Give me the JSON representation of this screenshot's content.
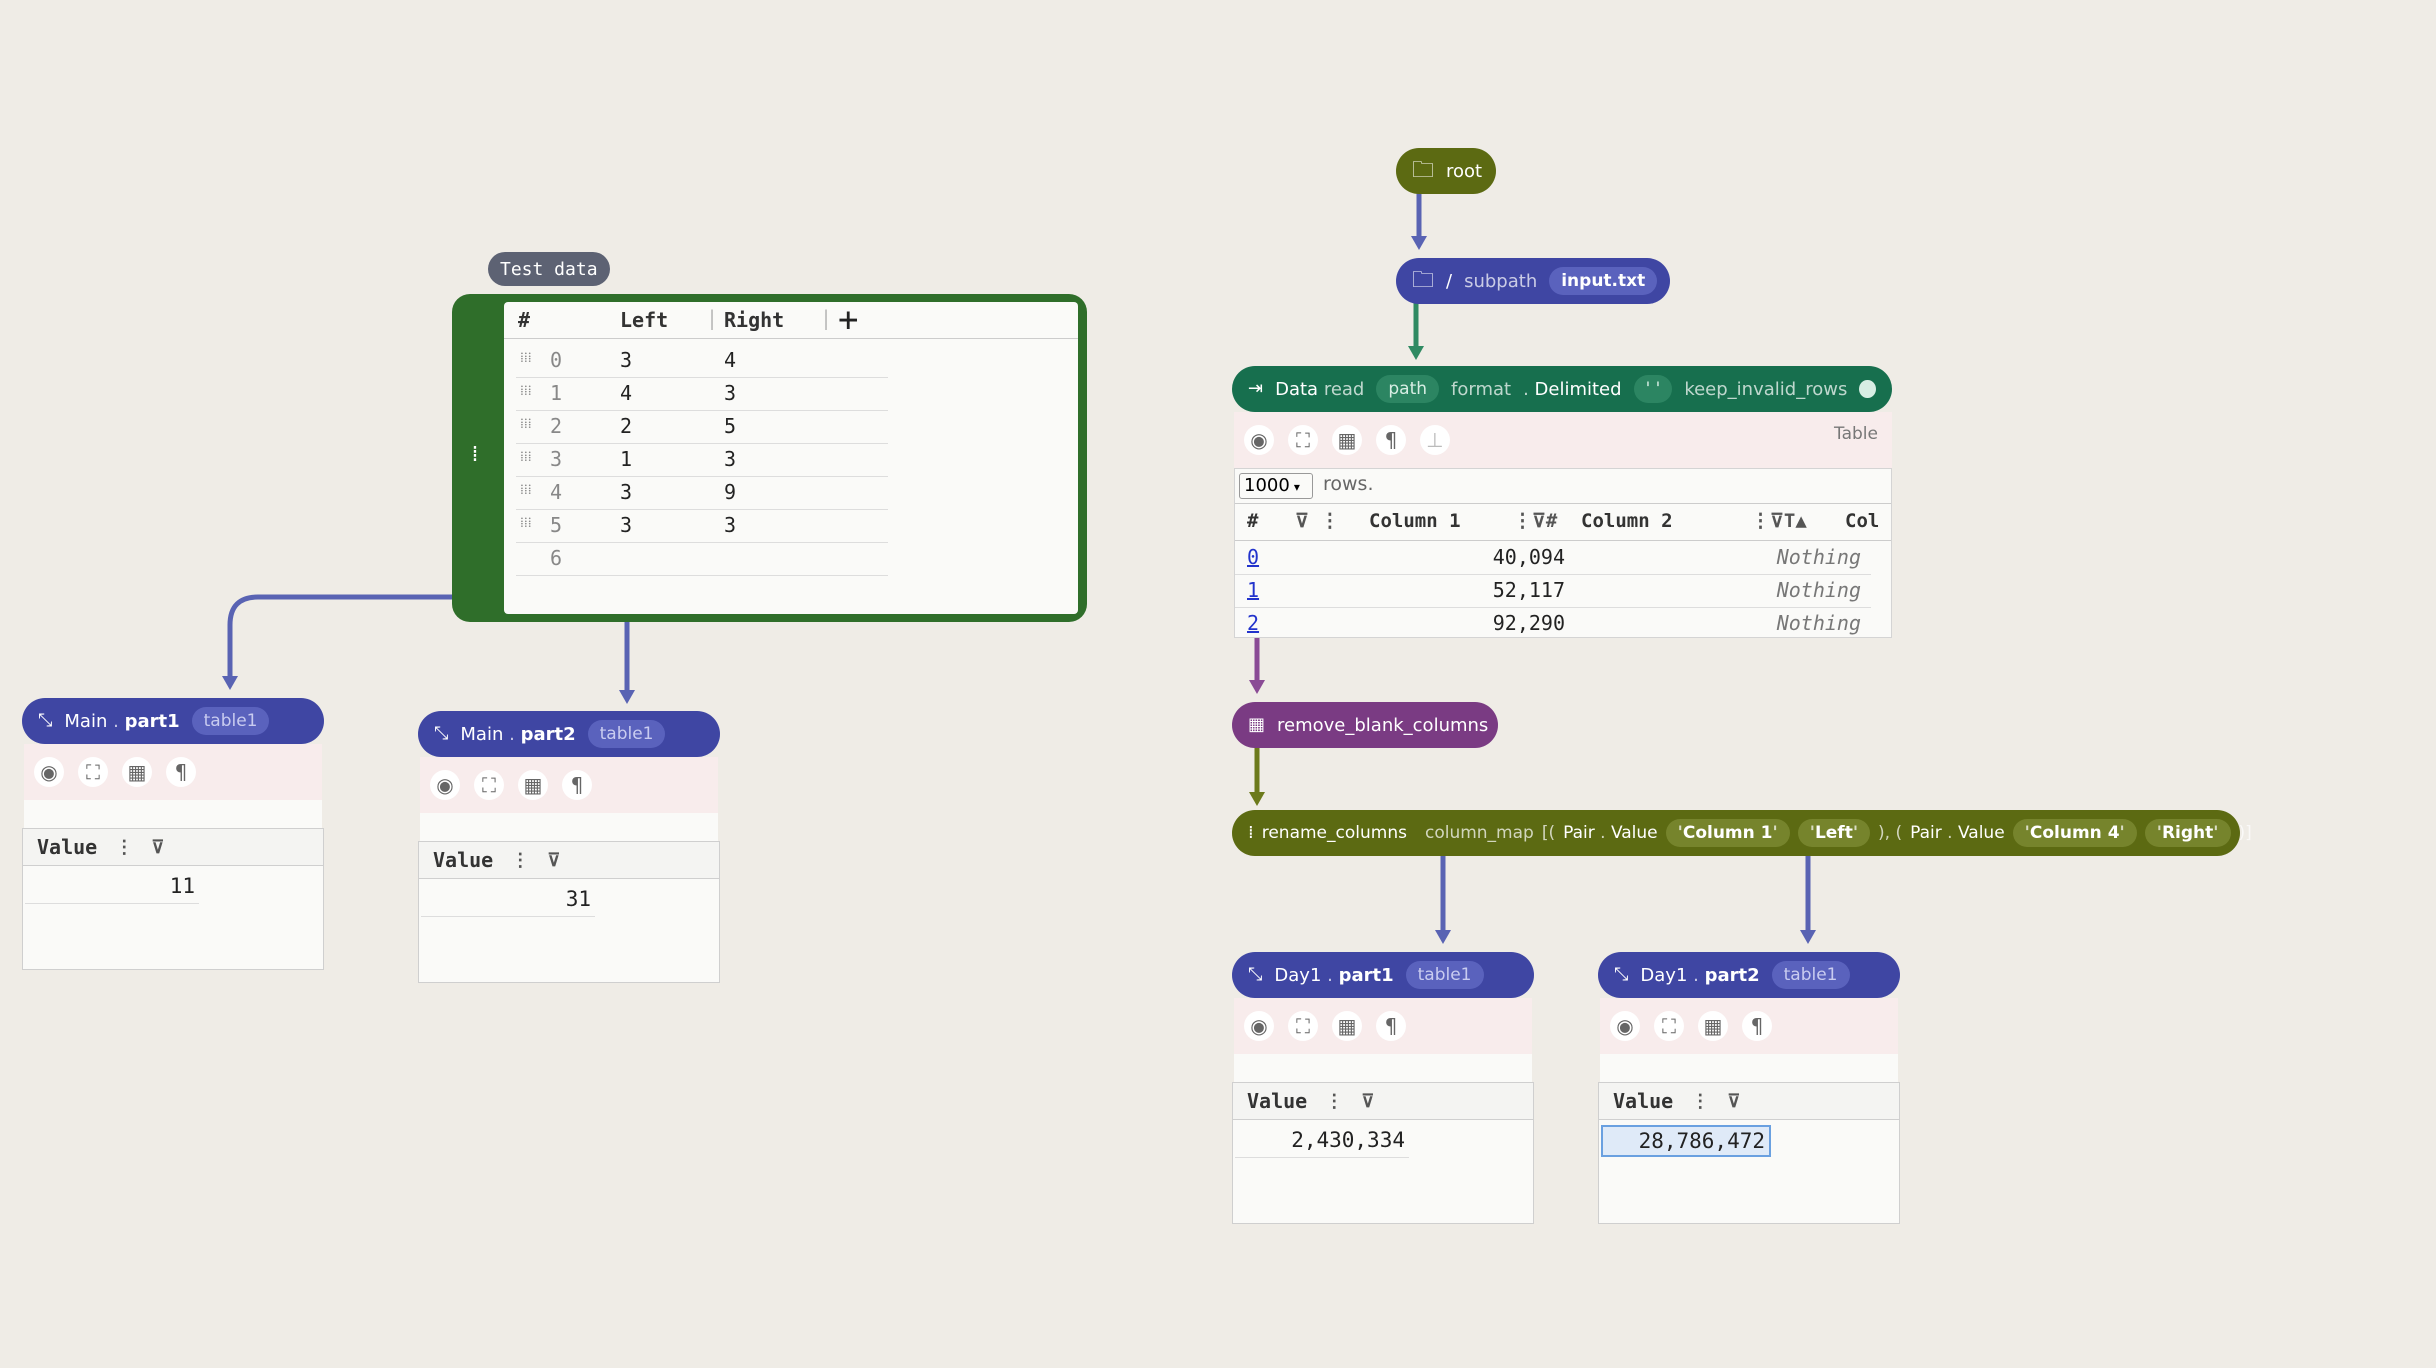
{
  "test_data": {
    "label": "Test data",
    "headers": [
      "#",
      "Left",
      "Right"
    ],
    "add_column": "+",
    "rows": [
      {
        "idx": "0",
        "left": "3",
        "right": "4"
      },
      {
        "idx": "1",
        "left": "4",
        "right": "3"
      },
      {
        "idx": "2",
        "left": "2",
        "right": "5"
      },
      {
        "idx": "3",
        "left": "1",
        "right": "3"
      },
      {
        "idx": "4",
        "left": "3",
        "right": "9"
      },
      {
        "idx": "5",
        "left": "3",
        "right": "3"
      },
      {
        "idx": "6",
        "left": "",
        "right": ""
      }
    ]
  },
  "root": {
    "label": "root"
  },
  "subpath_node": {
    "slash": "/",
    "name": "subpath",
    "arg": "input.txt"
  },
  "data_read": {
    "module": "Data",
    "method": "read",
    "path_chip": "path",
    "format_label": "format",
    "format_value": "Delimited",
    "delimiter": "' '",
    "keep_label": "keep_invalid_rows",
    "table_label": "Table",
    "rows_select": "1000",
    "rows_suffix": "rows.",
    "columns": [
      "#",
      "Column 1",
      "Column 2",
      "Col"
    ],
    "rows": [
      {
        "idx": "0",
        "c1": "40,094",
        "c2": "Nothing"
      },
      {
        "idx": "1",
        "c1": "52,117",
        "c2": "Nothing"
      },
      {
        "idx": "2",
        "c1": "92,290",
        "c2": "Nothing"
      }
    ]
  },
  "remove_blank": {
    "label": "remove_blank_columns"
  },
  "rename_columns": {
    "label": "rename_columns",
    "arg": "column_map",
    "open": "[(",
    "pair1_type": "Pair",
    "pair1_ctor": "Value",
    "pair1_a": "Column 1",
    "pair1_b": "Left",
    "mid": "), (",
    "pair2_type": "Pair",
    "pair2_ctor": "Value",
    "pair2_a": "Column 4",
    "pair2_b": "Right",
    "close": ")]"
  },
  "nodes": {
    "main_part1": {
      "module": "Main",
      "method": "part1",
      "arg": "table1",
      "col": "Value",
      "value": "11"
    },
    "main_part2": {
      "module": "Main",
      "method": "part2",
      "arg": "table1",
      "col": "Value",
      "value": "31"
    },
    "day1_part1": {
      "module": "Day1",
      "method": "part1",
      "arg": "table1",
      "col": "Value",
      "value": "2,430,334"
    },
    "day1_part2": {
      "module": "Day1",
      "method": "part2",
      "arg": "table1",
      "col": "Value",
      "value": "28,786,472"
    }
  },
  "colors": {
    "blue": "#3f46a3",
    "olive": "#5c6a12",
    "teal": "#176f4e",
    "purple": "#7a3b83",
    "green_frame": "#2f6e2a",
    "background": "#efece6"
  }
}
